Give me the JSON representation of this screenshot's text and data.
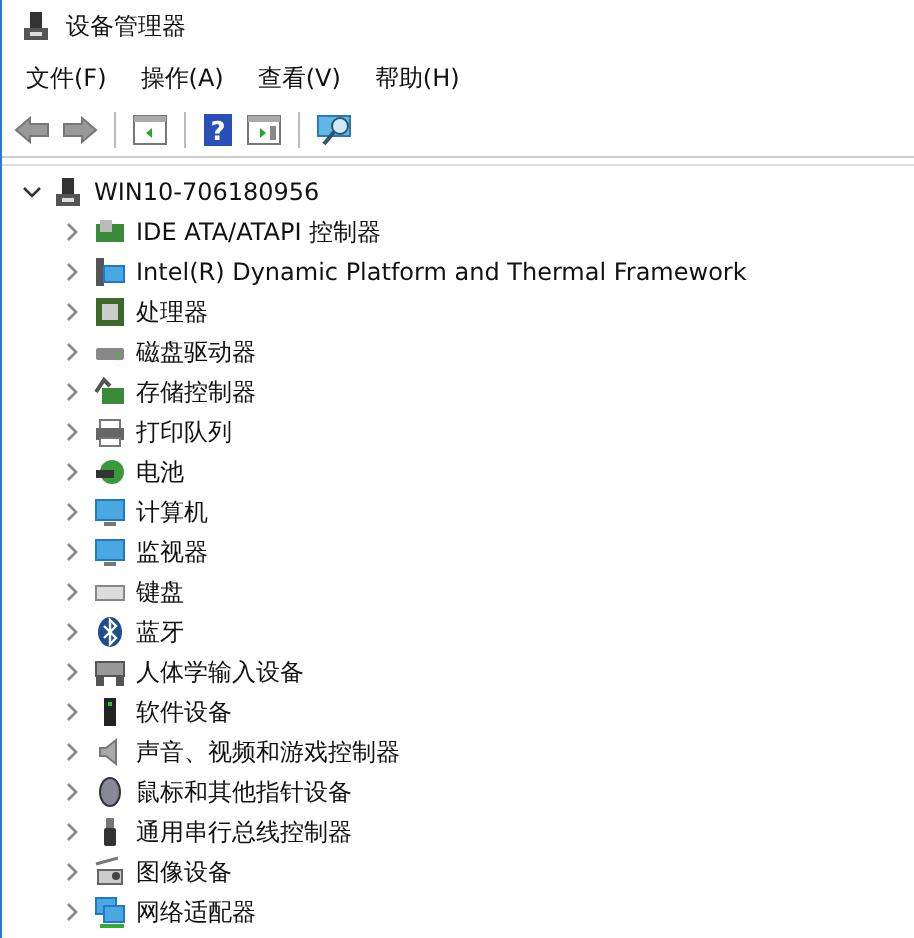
{
  "window": {
    "title": "设备管理器"
  },
  "menu": [
    "文件(F)",
    "操作(A)",
    "查看(V)",
    "帮助(H)"
  ],
  "toolbar": {
    "help_glyph": "?"
  },
  "tree": {
    "label": "WIN10-706180956",
    "expanded": true,
    "children": [
      {
        "label": "IDE ATA/ATAPI 控制器",
        "kind": "controller"
      },
      {
        "label": "Intel(R) Dynamic Platform and Thermal Framework",
        "kind": "system"
      },
      {
        "label": "处理器",
        "kind": "chip"
      },
      {
        "label": "磁盘驱动器",
        "kind": "disk"
      },
      {
        "label": "存储控制器",
        "kind": "storage"
      },
      {
        "label": "打印队列",
        "kind": "printer"
      },
      {
        "label": "电池",
        "kind": "battery"
      },
      {
        "label": "计算机",
        "kind": "monitor"
      },
      {
        "label": "监视器",
        "kind": "monitor"
      },
      {
        "label": "键盘",
        "kind": "keyboard"
      },
      {
        "label": "蓝牙",
        "kind": "bluetooth"
      },
      {
        "label": "人体学输入设备",
        "kind": "hid"
      },
      {
        "label": "软件设备",
        "kind": "device"
      },
      {
        "label": "声音、视频和游戏控制器",
        "kind": "speaker"
      },
      {
        "label": "鼠标和其他指针设备",
        "kind": "mouse"
      },
      {
        "label": "通用串行总线控制器",
        "kind": "usb"
      },
      {
        "label": "图像设备",
        "kind": "camera"
      },
      {
        "label": "网络适配器",
        "kind": "network"
      }
    ]
  }
}
